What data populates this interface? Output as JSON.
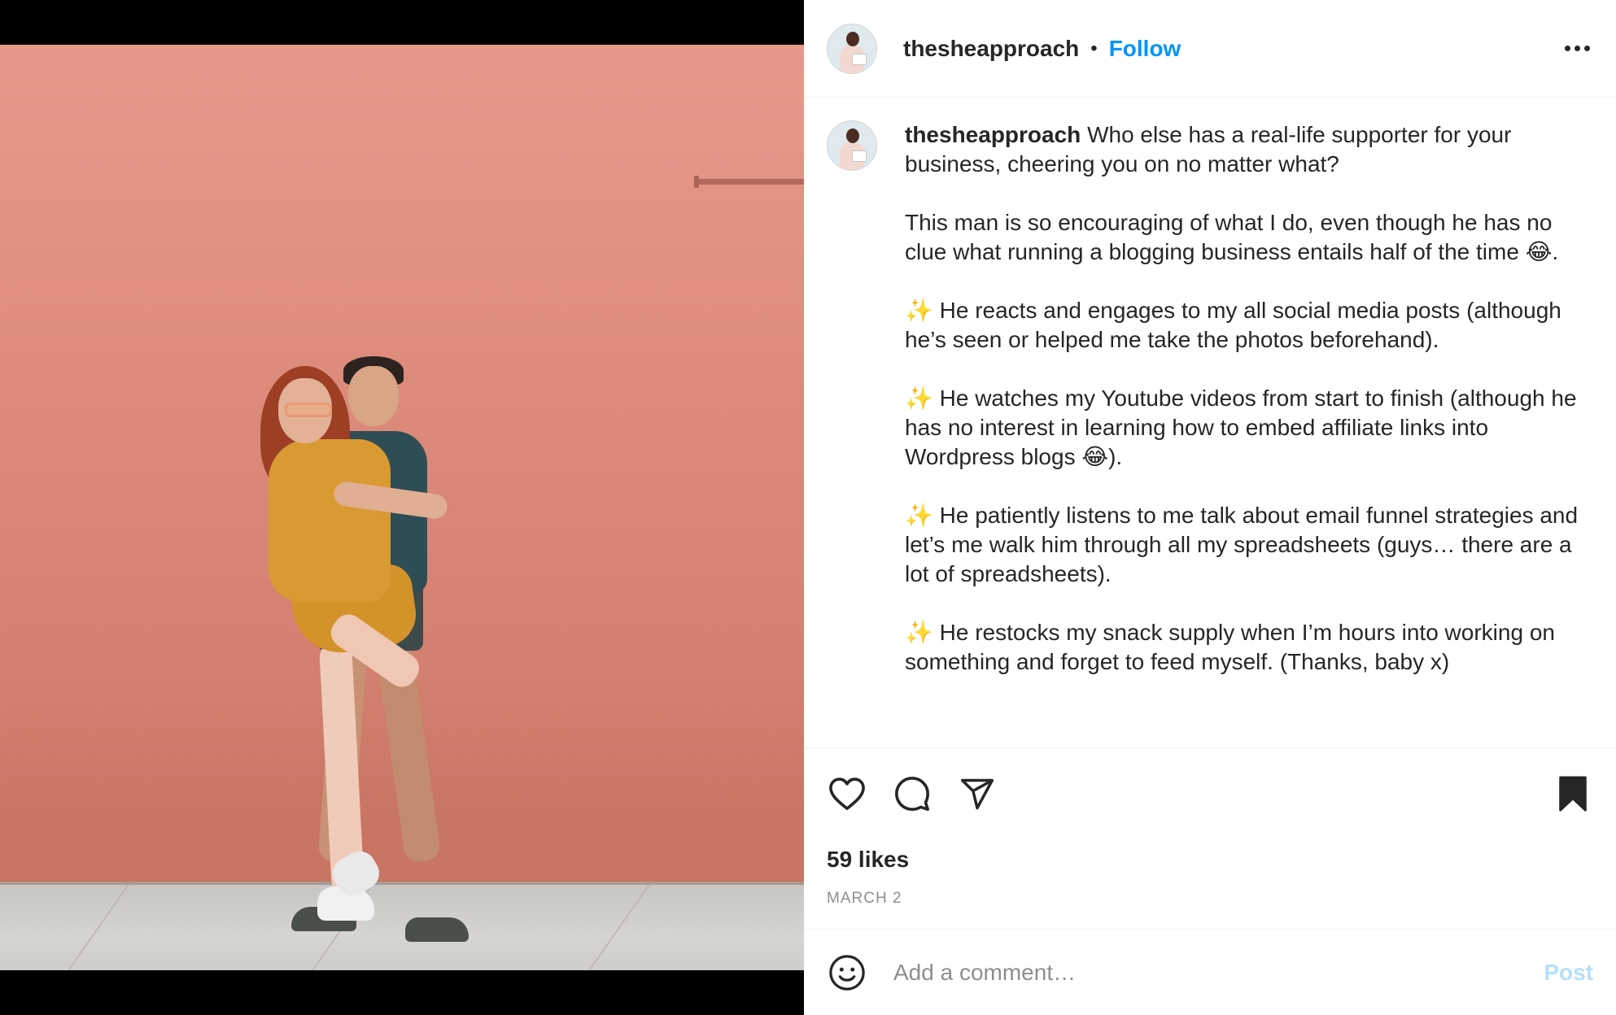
{
  "header": {
    "username": "thesheapproach",
    "separator": "•",
    "follow_label": "Follow"
  },
  "caption": {
    "username": "thesheapproach",
    "paragraphs": [
      "Who else has a real-life supporter for your business, cheering you on no matter what?",
      "This man is so encouraging of what I do, even though he has no clue what running a blogging business entails half of the time 😂.",
      "✨ He reacts and engages to my all social media posts (although he’s seen or helped me take the photos beforehand).",
      "✨ He watches my Youtube videos from start to finish (although he has no interest in learning how to embed affiliate links into Wordpress blogs 😂).",
      "✨ He patiently listens to me talk about email funnel strategies and let’s me walk him through all my spreadsheets (guys… there are a lot of spreadsheets).",
      "✨ He restocks my snack supply when I’m hours into working on something and forget to feed myself. (Thanks, baby x)"
    ]
  },
  "actions": {
    "like_icon": "heart-icon",
    "comment_icon": "comment-icon",
    "share_icon": "paper-plane-icon",
    "save_icon": "bookmark-icon"
  },
  "likes": "59 likes",
  "date": "MARCH 2",
  "comment": {
    "placeholder": "Add a comment…",
    "post_label": "Post",
    "emoji_icon": "smiley-icon"
  },
  "colors": {
    "accent": "#0095f6",
    "post_disabled": "#b2dffc",
    "wall": "#d98a7a"
  }
}
